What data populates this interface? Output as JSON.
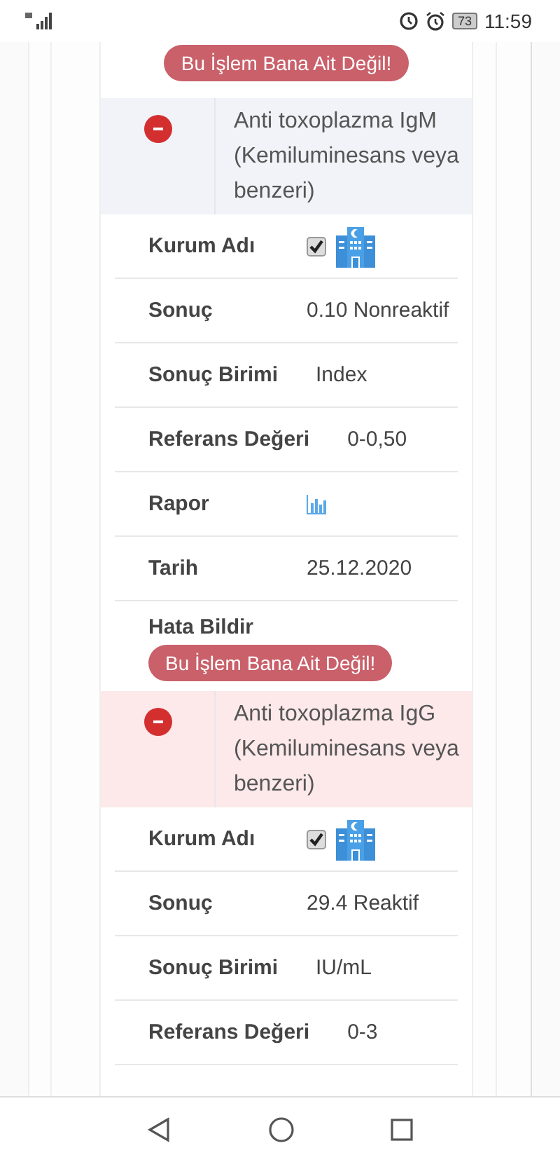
{
  "status_bar": {
    "battery": "73",
    "time": "11:59"
  },
  "previous_action": {
    "button": "Bu İşlem Bana Ait Değil!"
  },
  "tests": [
    {
      "name": "Anti toxoplazma IgM (Kemiluminesans veya benzeri)",
      "highlighted": false,
      "rows": [
        {
          "kind": "institution",
          "label": "Kurum Adı",
          "checked": true
        },
        {
          "kind": "text",
          "label": "Sonuç",
          "value": "0.10 Nonreaktif"
        },
        {
          "kind": "text",
          "label": "Sonuç Birimi",
          "value": "Index"
        },
        {
          "kind": "text",
          "label": "Referans Değeri",
          "value": "0-0,50"
        },
        {
          "kind": "report",
          "label": "Rapor"
        },
        {
          "kind": "text",
          "label": "Tarih",
          "value": "25.12.2020"
        },
        {
          "kind": "action",
          "label": "Hata Bildir",
          "button": "Bu İşlem Bana Ait Değil!"
        }
      ]
    },
    {
      "name": "Anti toxoplazma IgG (Kemiluminesans veya benzeri)",
      "highlighted": true,
      "rows": [
        {
          "kind": "institution",
          "label": "Kurum Adı",
          "checked": true
        },
        {
          "kind": "text",
          "label": "Sonuç",
          "value": "29.4 Reaktif"
        },
        {
          "kind": "text",
          "label": "Sonuç Birimi",
          "value": "IU/mL"
        },
        {
          "kind": "text",
          "label": "Referans Değeri",
          "value": "0-3"
        }
      ]
    }
  ]
}
